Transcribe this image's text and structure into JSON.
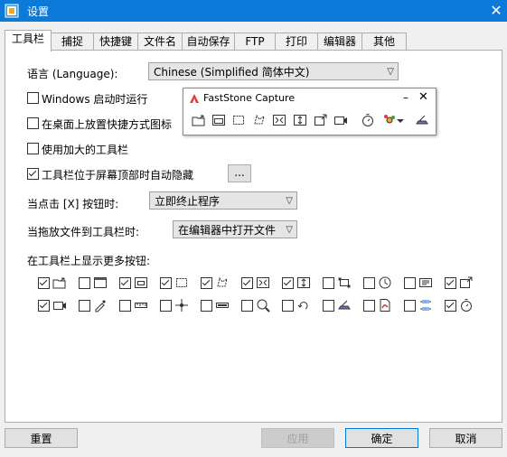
{
  "window": {
    "title": "设置",
    "close_glyph": "✕"
  },
  "tabs": [
    {
      "label": "工具栏",
      "active": true
    },
    {
      "label": "捕捉"
    },
    {
      "label": "快捷键"
    },
    {
      "label": "文件名"
    },
    {
      "label": "自动保存"
    },
    {
      "label": "FTP"
    },
    {
      "label": "打印"
    },
    {
      "label": "编辑器"
    },
    {
      "label": "其他"
    }
  ],
  "language": {
    "label": "语言 (Language):",
    "value": "Chinese (Simplified 简体中文)"
  },
  "options": [
    {
      "label": "Windows 启动时运行",
      "checked": false
    },
    {
      "label": "在桌面上放置快捷方式图标",
      "checked": false
    },
    {
      "label": "使用加大的工具栏",
      "checked": false
    },
    {
      "label": "工具栏位于屏幕顶部时自动隐藏",
      "checked": true
    }
  ],
  "ellipsis_label": "...",
  "click_close": {
    "label": "当点击 [X] 按钮时:",
    "value": "立即终止程序"
  },
  "drop_file": {
    "label": "当拖放文件到工具栏时:",
    "value": "在编辑器中打开文件"
  },
  "more_buttons_label": "在工具栏上显示更多按钮:",
  "floating_toolbar": {
    "title": "FastStone Capture",
    "min_glyph": "–",
    "close_glyph": "✕"
  },
  "more_buttons": [
    {
      "icon": "open-folder-icon",
      "checked": true
    },
    {
      "icon": "window-capture-icon",
      "checked": false
    },
    {
      "icon": "object-capture-icon",
      "checked": true
    },
    {
      "icon": "rectangle-capture-icon",
      "checked": true
    },
    {
      "icon": "freehand-capture-icon",
      "checked": true
    },
    {
      "icon": "fullscreen-capture-icon",
      "checked": true
    },
    {
      "icon": "scrolling-capture-icon",
      "checked": true
    },
    {
      "icon": "fixed-region-icon",
      "checked": false
    },
    {
      "icon": "clock-icon",
      "checked": false
    },
    {
      "icon": "text-note-icon",
      "checked": false
    },
    {
      "icon": "output-icon",
      "checked": true
    },
    {
      "icon": "screen-recorder-icon",
      "checked": true
    },
    {
      "icon": "color-picker-icon",
      "checked": false
    },
    {
      "icon": "ruler-icon",
      "checked": false
    },
    {
      "icon": "crosshair-icon",
      "checked": false
    },
    {
      "icon": "screen-bar-icon",
      "checked": false
    },
    {
      "icon": "magnifier-icon",
      "checked": false
    },
    {
      "icon": "undo-arrow-icon",
      "checked": false
    },
    {
      "icon": "scanner-icon",
      "checked": false
    },
    {
      "icon": "pdf-icon",
      "checked": false
    },
    {
      "icon": "split-icon",
      "checked": false
    },
    {
      "icon": "timer-icon",
      "checked": true
    }
  ],
  "buttons": {
    "reset": "重置",
    "apply": "应用",
    "ok": "确定",
    "cancel": "取消"
  },
  "colors": {
    "titlebar": "#0b7ad8",
    "accent": "#0078d7"
  }
}
